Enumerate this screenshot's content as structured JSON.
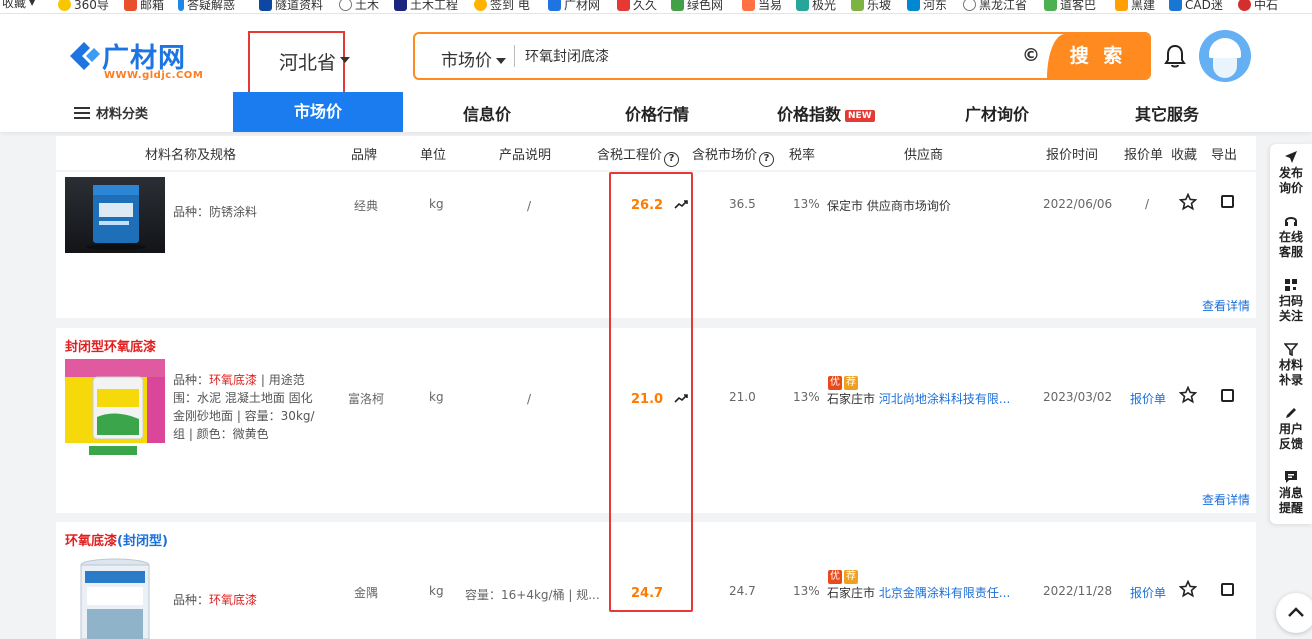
{
  "bookmarks": [
    {
      "label": "收藏",
      "color": "#ffffff"
    },
    {
      "label": "360导",
      "color": "#f7c600"
    },
    {
      "label": "邮箱",
      "color": "#e94f2c"
    },
    {
      "label": "答疑解惑",
      "color": "#1e88e5"
    },
    {
      "label": "隧道资料",
      "color": "#0d47a1"
    },
    {
      "label": "土木",
      "color": "#777777"
    },
    {
      "label": "土木工程",
      "color": "#1a237e"
    },
    {
      "label": "签到 电",
      "color": "#ffb300"
    },
    {
      "label": "广材网",
      "color": "#1e74e0"
    },
    {
      "label": "久久",
      "color": "#e53935"
    },
    {
      "label": "绿色网",
      "color": "#43a047"
    },
    {
      "label": "当易",
      "color": "#ff7043"
    },
    {
      "label": "极光",
      "color": "#26a69a"
    },
    {
      "label": "乐坡",
      "color": "#7cb342"
    },
    {
      "label": "河东",
      "color": "#0288d1"
    },
    {
      "label": "黑龙江省",
      "color": "#777777"
    },
    {
      "label": "道客巴",
      "color": "#4caf50"
    },
    {
      "label": "黑建",
      "color": "#ffa000"
    },
    {
      "label": "CAD迷",
      "color": "#1976d2"
    },
    {
      "label": "中石",
      "color": "#d32f2f"
    }
  ],
  "header": {
    "logo_name": "广材网",
    "logo_url": "WWW.gldjc.COM",
    "region": "河北省",
    "search_type": "市场价",
    "search_value": "环氧封闭底漆",
    "search_clear": "©",
    "search_button": "搜 索"
  },
  "nav": {
    "category": "材料分类",
    "active": "市场价",
    "items": [
      "信息价",
      "价格行情",
      "价格指数",
      "广材询价",
      "其它服务"
    ],
    "new_badge": "NEW"
  },
  "table_headers": {
    "name": "材料名称及规格",
    "brand": "品牌",
    "unit": "单位",
    "desc": "产品说明",
    "tax_eng_price": "含税工程价",
    "tax_market_price": "含税市场价",
    "tax_rate": "税率",
    "supplier": "供应商",
    "date": "报价时间",
    "quote": "报价单",
    "fav": "收藏",
    "export": "导出"
  },
  "rows": [
    {
      "title_part1": "",
      "title_part2": "",
      "desc_prefix": "品种：",
      "desc_hl": "",
      "desc_rest": "防锈涂料",
      "brand": "经典",
      "unit": "kg",
      "product_desc": "/",
      "eng_price": "26.2",
      "market_price": "36.5",
      "tax_rate": "13%",
      "supplier_city": "保定市",
      "supplier_name": "供应商市场询价",
      "date": "2022/06/06",
      "quote": "/",
      "more": "查看详情"
    },
    {
      "title_part1": "封闭型",
      "title_part2": "环氧底漆",
      "desc_prefix": "品种：",
      "desc_hl": "环氧底漆",
      "desc_rest": " | 用途范围：水泥 混凝土地面 固化金刚砂地面 | 容量：30kg/组 | 颜色：微黄色",
      "brand": "富洛柯",
      "unit": "kg",
      "product_desc": "/",
      "eng_price": "21.0",
      "market_price": "21.0",
      "tax_rate": "13%",
      "badge1": "优",
      "badge2": "荐",
      "supplier_city": "石家庄市",
      "supplier_name": "河北尚地涂料科技有限...",
      "date": "2023/03/02",
      "quote": "报价单",
      "more": "查看详情"
    },
    {
      "title_part1": "环氧底漆",
      "title_part2": "(封闭型)",
      "desc_prefix": "品种：",
      "desc_hl": "环氧底漆",
      "desc_rest": "",
      "brand": "金隅",
      "unit": "kg",
      "product_desc": "容量：16+4kg/桶 | 规...",
      "eng_price": "24.7",
      "market_price": "24.7",
      "tax_rate": "13%",
      "badge1": "优",
      "badge2": "荐",
      "supplier_city": "石家庄市",
      "supplier_name": "北京金隅涂料有限责任...",
      "date": "2022/11/28",
      "quote": "报价单"
    }
  ],
  "rail": [
    {
      "line1": "发布",
      "line2": "询价"
    },
    {
      "line1": "在线",
      "line2": "客服"
    },
    {
      "line1": "扫码",
      "line2": "关注"
    },
    {
      "line1": "材料",
      "line2": "补录"
    },
    {
      "line1": "用户",
      "line2": "反馈"
    },
    {
      "line1": "消息",
      "line2": "提醒"
    }
  ],
  "colors": {
    "brand_blue": "#1b7cf0",
    "accent_orange": "#ff8a1f",
    "highlight_red": "#e02020"
  }
}
